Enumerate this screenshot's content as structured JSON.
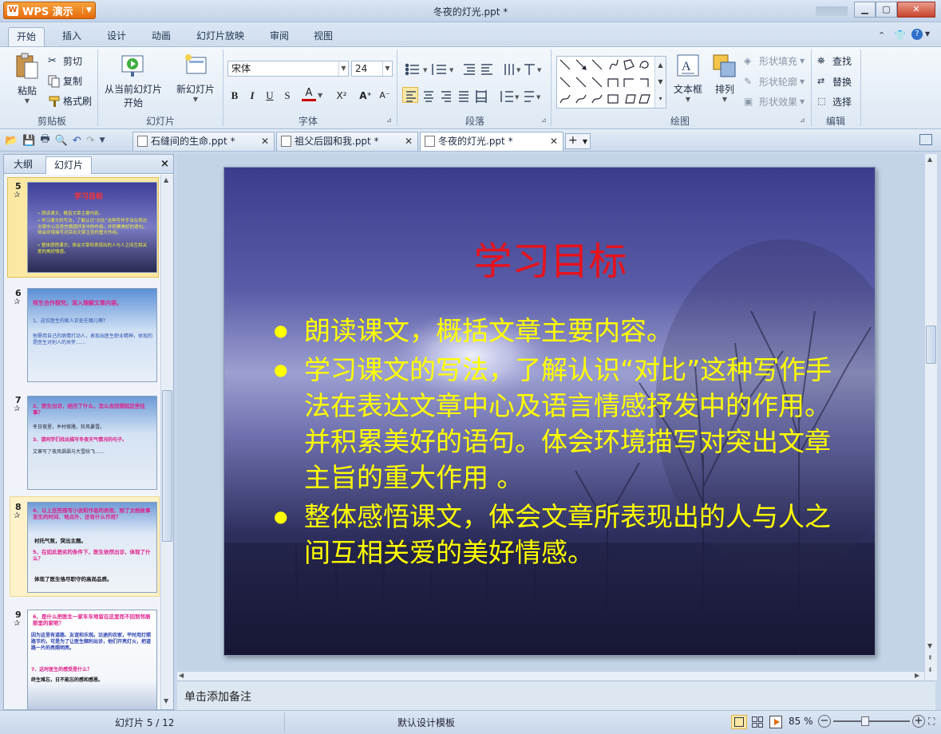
{
  "app": {
    "name": "WPS 演示",
    "window_title": "冬夜的灯光.ppt *"
  },
  "menu_tabs": [
    "开始",
    "插入",
    "设计",
    "动画",
    "幻灯片放映",
    "审阅",
    "视图"
  ],
  "ribbon": {
    "clipboard": {
      "paste": "粘贴",
      "cut": "剪切",
      "copy": "复制",
      "format_painter": "格式刷",
      "group": "剪贴板"
    },
    "slideshow": {
      "from_current_1": "从当前幻灯片",
      "from_current_2": "开始",
      "group": "幻灯片"
    },
    "new_slide": "新幻灯片",
    "font": {
      "name": "宋体",
      "size": "24",
      "bold": "B",
      "italic": "I",
      "underline": "U",
      "shadow": "S",
      "color": "A",
      "superscript": "X²",
      "grow": "A⁺",
      "shrink": "A⁻",
      "group": "字体"
    },
    "paragraph": {
      "group": "段落"
    },
    "drawing": {
      "textbox": "文本框",
      "arrange": "排列",
      "fill": "形状填充",
      "outline": "形状轮廓",
      "effect": "形状效果",
      "group": "绘图"
    },
    "edit": {
      "find": "查找",
      "replace": "替换",
      "select": "选择",
      "group": "编辑"
    }
  },
  "doc_tabs": [
    {
      "label": "石缝间的生命.ppt *"
    },
    {
      "label": "祖父后园和我.ppt *"
    },
    {
      "label": "冬夜的灯光.ppt *"
    }
  ],
  "left_panel": {
    "tab_outline": "大纲",
    "tab_slides": "幻灯片",
    "close": "×"
  },
  "thumbnails": [
    {
      "num": "5",
      "title": "学习目标",
      "lines": [
        "• 朗读课文，概括文章主要内容。",
        "• 学习课文的写法，了解认识“对比”这种写作手法在表达文章中心及语言情感抒发中的作用。并积累美好的语句。体会环境描写对突出文章主旨的重大作用。",
        "• 整体感悟课文，体会文章所表现出的人与人之间互相关爱的美好情感。"
      ]
    },
    {
      "num": "6",
      "title": "师生合作探究，深入理解文章内容。",
      "lines": [
        "1、这位医生的家人正处在哪儿啊？",
        "他需用自己的病情打动人，表现出医生职业精神，体现的是医生对别人的关怀……"
      ]
    },
    {
      "num": "7",
      "title": "2、医生出诊，经历了什么，怎么会回想起这些往事？",
      "lines": [
        "冬日夜里，乡村夜路，狂风暴雪。",
        "3、请同学们找出描写冬夜天气情况的句子。",
        "文章写了夜风飒飒与大雪纷飞……"
      ]
    },
    {
      "num": "8",
      "title": "4、以上这些描写小说和作者的表现，除了文档故事发生的时间、地点外，还有什么作用？",
      "lines": [
        "衬托气氛，突出主题。",
        "5、在如此恶劣的条件下，医生依然出诊，体现了什么？",
        "体现了医生恪尽职守的高尚品质。"
      ]
    },
    {
      "num": "9",
      "title": "6、是什么把医生一家车车地留在这里而不回到邻居那里的家呢？",
      "lines": [
        "因为这里有道路、友谊和乐观。沿途的农家，平时用灯照路节约，可是为了让医生顺利出诊，他们开亮灯火，把道路一片的亮照明亮。",
        "7、这时医生的感受是什么？",
        "终生难忘，日不能忘的感和感恩。"
      ]
    }
  ],
  "slide": {
    "title": "学习目标",
    "bullets": [
      "朗读课文，概括文章主要内容。",
      "学习课文的写法，了解认识“对比”这种写作手法在表达文章中心及语言情感抒发中的作用。并积累美好的语句。体会环境描写对突出文章主旨的重大作用 。",
      "整体感悟课文，体会文章所表现出的人与人之间互相关爱的美好情感。"
    ],
    "title_color": "#e8121a",
    "text_color": "#ffff00"
  },
  "notes_placeholder": "单击添加备注",
  "status": {
    "slide_info": "幻灯片 5 / 12",
    "template": "默认设计模板",
    "zoom": "85 %"
  }
}
